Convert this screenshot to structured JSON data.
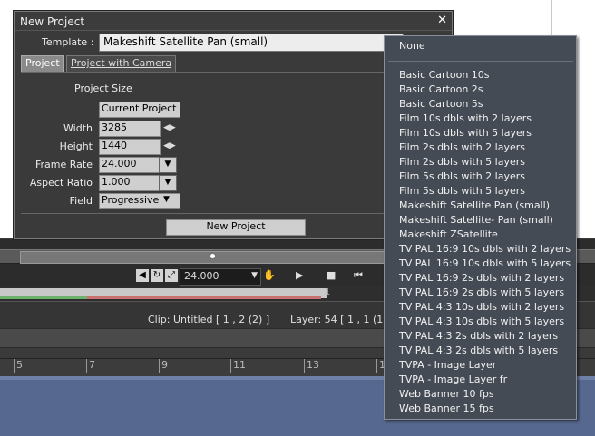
{
  "dialog": {
    "title": "New Project",
    "close_glyph": "✕",
    "template_label": "Template :",
    "template_value": "Makeshift Satellite Pan (small)",
    "tabs": [
      {
        "label": "Project",
        "active": true
      },
      {
        "label": "Project with Camera",
        "active": false
      }
    ],
    "project_size_label": "Project Size",
    "preset_value": "Current Project",
    "fields": {
      "width": {
        "label": "Width",
        "value": "3285"
      },
      "height": {
        "label": "Height",
        "value": "1440"
      },
      "frame_rate": {
        "label": "Frame Rate",
        "value": "24.000"
      },
      "aspect_ratio": {
        "label": "Aspect Ratio",
        "value": "1.000"
      },
      "field": {
        "label": "Field",
        "value": "Progressive"
      }
    },
    "new_project_label": "New Project"
  },
  "dropdown": {
    "first": "None",
    "items": [
      "Basic Cartoon 10s",
      "Basic Cartoon 2s",
      "Basic Cartoon 5s",
      "Film 10s dbls with 2 layers",
      "Film 10s dbls with 5 layers",
      "Film 2s dbls with 2 layers",
      "Film 2s dbls with 5 layers",
      "Film 5s dbls with 2 layers",
      "Film 5s dbls with 5 layers",
      "Makeshift Satellite Pan (small)",
      "Makeshift Satellite- Pan (small)",
      "Makeshift ZSatellite",
      "TV PAL 16:9 10s dbls with 2 layers",
      "TV PAL 16:9 10s dbls with 5 layers",
      "TV PAL 16:9 2s dbls with 2 layers",
      "TV PAL 16:9 2s dbls with 5 layers",
      "TV PAL 4:3 10s dbls with 2 layers",
      "TV PAL 4:3 10s dbls with 5 layers",
      "TV PAL 4:3 2s dbls with 2 layers",
      "TV PAL 4:3 2s dbls with 5 layers",
      "TVPA - Image Layer",
      "TVPA - Image Layer fr",
      "Web Banner 10 fps",
      "Web Banner 15 fps"
    ]
  },
  "transport": {
    "fps": "24.000",
    "fps_arrow": "▼",
    "hand_icon": "✋",
    "play_icon": "▶",
    "stop_icon": "■",
    "rewind_icon": "⏮"
  },
  "progress": {
    "frame_label": "1",
    "green_fraction": 0.27
  },
  "status": {
    "clip": "Clip: Untitled [ 1 , 2  (2) ]",
    "layer": "Layer: 54 [ 1 , 1  (1)"
  },
  "ruler": {
    "ticks": [
      "5",
      "7",
      "9",
      "11",
      "13",
      "1"
    ]
  },
  "icons": {
    "sound": "speaker-icon",
    "loop": "loop-icon",
    "sync": "sync-icon",
    "dropdown_arrow": "chevron-down-icon",
    "spin": "spin-arrows-icon"
  }
}
